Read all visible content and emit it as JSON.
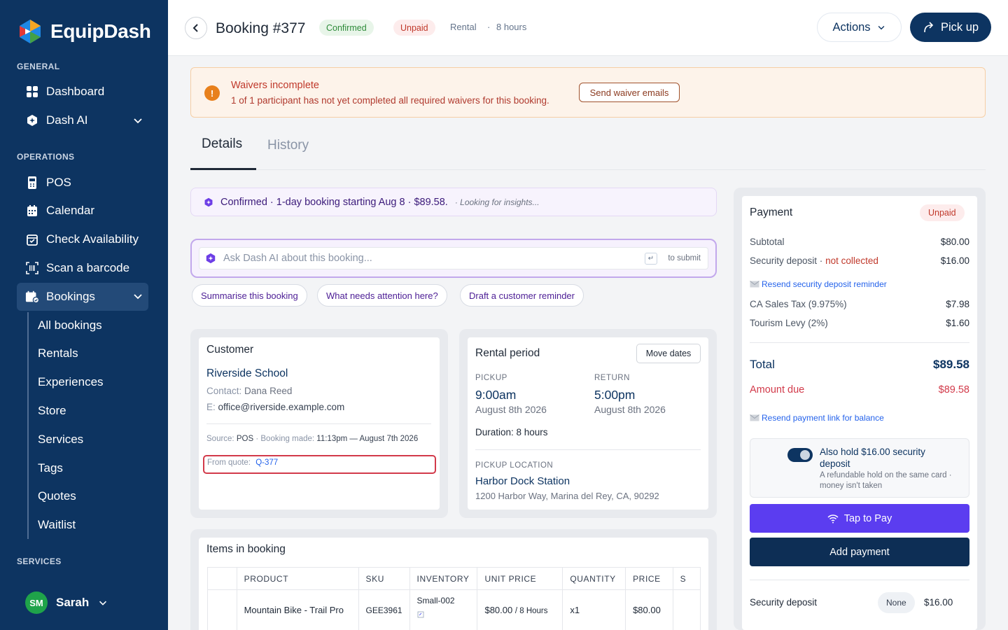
{
  "app": {
    "name": "EquipDash"
  },
  "sidebar": {
    "sections": {
      "general": "GENERAL",
      "operations": "OPERATIONS",
      "services": "SERVICES"
    },
    "general_items": [
      {
        "label": "Dashboard",
        "icon": "grid-icon"
      },
      {
        "label": "Dash AI",
        "icon": "ai-shield-icon"
      }
    ],
    "operations_items": [
      {
        "label": "POS",
        "icon": "pos-terminal-icon"
      },
      {
        "label": "Calendar",
        "icon": "calendar-icon"
      },
      {
        "label": "Check Availability",
        "icon": "calendar-check-icon"
      },
      {
        "label": "Scan a barcode",
        "icon": "barcode-icon"
      },
      {
        "label": "Bookings",
        "icon": "bookings-icon"
      }
    ],
    "bookings_subitems": [
      "All bookings",
      "Rentals",
      "Experiences",
      "Store",
      "Services",
      "Tags",
      "Quotes",
      "Waitlist"
    ],
    "user": {
      "initials": "SM",
      "name": "Sarah"
    }
  },
  "header": {
    "title": "Booking #377",
    "status_badge": "Confirmed",
    "payment_badge": "Unpaid",
    "type": "Rental",
    "separator": "·",
    "duration": "8 hours",
    "actions_label": "Actions",
    "pickup_label": "Pick up"
  },
  "banner": {
    "icon_glyph": "!",
    "title": "Waivers incomplete",
    "text": "1 of 1 participant has not yet completed all required waivers for this booking.",
    "button": "Send waiver emails"
  },
  "tabs": {
    "details": "Details",
    "history": "History"
  },
  "insight": {
    "text": "Confirmed · 1-day booking starting Aug 8 · $89.58.",
    "sub": "· Looking for insights..."
  },
  "ask": {
    "placeholder": "Ask Dash AI about this booking...",
    "enter_glyph": "↵",
    "hint": "to submit"
  },
  "chips": [
    "Summarise this booking",
    "What needs attention here?",
    "Draft a customer reminder"
  ],
  "customer": {
    "title": "Customer",
    "name": "Riverside School",
    "contact_label": "Contact:",
    "contact_value": "Dana Reed",
    "email_label": "E:",
    "email_value": "office@riverside.example.com",
    "source_label": "Source:",
    "source_value": "POS",
    "booking_made_label": "Booking made:",
    "booking_made_value": "11:13pm — August 7th 2026",
    "quote_label": "From quote:",
    "quote_value": "Q-377"
  },
  "rental": {
    "title": "Rental period",
    "move_dates": "Move dates",
    "pickup_cap": "PICKUP",
    "pickup_time": "9:00am",
    "pickup_date": "August 8th 2026",
    "return_cap": "RETURN",
    "return_time": "5:00pm",
    "return_date": "August 8th 2026",
    "duration": "Duration: 8 hours",
    "location_cap": "PICKUP LOCATION",
    "location_name": "Harbor Dock Station",
    "location_address": "1200 Harbor Way, Marina del Rey, CA, 90292"
  },
  "items": {
    "title": "Items in booking",
    "columns": [
      "PRODUCT",
      "SKU",
      "INVENTORY",
      "UNIT PRICE",
      "QUANTITY",
      "PRICE",
      "S"
    ],
    "rows": [
      {
        "product": "Mountain Bike - Trail Pro",
        "sku": "GEE3961",
        "inventory": "Small-002",
        "unit_price": "$80.00",
        "unit_suffix": "/ 8 Hours",
        "quantity": "x1",
        "price": "$80.00"
      }
    ]
  },
  "payment": {
    "title": "Payment",
    "status": "Unpaid",
    "subtotal_label": "Subtotal",
    "subtotal": "$80.00",
    "deposit_label": "Security deposit ·",
    "deposit_status": "not collected",
    "deposit": "$16.00",
    "resend_deposit": "Resend security deposit reminder",
    "tax_label": "CA Sales Tax (9.975%)",
    "tax": "$7.98",
    "levy_label": "Tourism Levy (2%)",
    "levy": "$1.60",
    "total_label": "Total",
    "total": "$89.58",
    "due_label": "Amount due",
    "due": "$89.58",
    "resend_payment": "Resend payment link for balance",
    "hold_title": "Also hold $16.00 security deposit",
    "hold_sub": "A refundable hold on the same card · money isn't taken",
    "hold_enabled": true,
    "tap_to_pay": "Tap to Pay",
    "add_payment": "Add payment",
    "footer_label": "Security deposit",
    "footer_badge": "None",
    "footer_value": "$16.00"
  },
  "colors": {
    "brand_navy": "#0d3461",
    "tap_purple": "#5b3df0",
    "danger": "#d23a4a",
    "success": "#2e8b3a"
  }
}
